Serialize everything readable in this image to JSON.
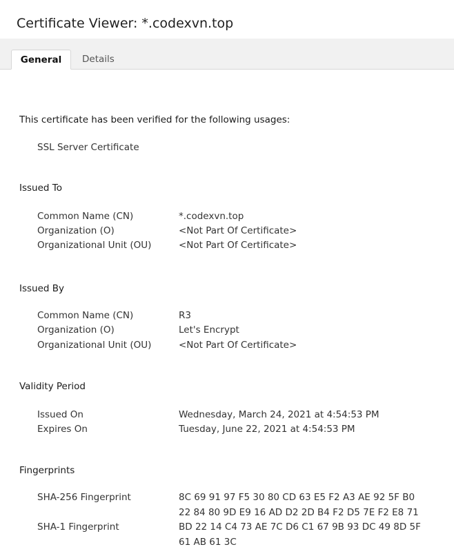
{
  "window": {
    "title": "Certificate Viewer: *.codexvn.top"
  },
  "tabs": [
    {
      "label": "General",
      "active": true
    },
    {
      "label": "Details",
      "active": false
    }
  ],
  "general": {
    "verified_text": "This certificate has been verified for the following usages:",
    "usage": "SSL Server Certificate",
    "issued_to": {
      "heading": "Issued To",
      "common_name_label": "Common Name (CN)",
      "common_name_value": "*.codexvn.top",
      "organization_label": "Organization (O)",
      "organization_value": "<Not Part Of Certificate>",
      "org_unit_label": "Organizational Unit (OU)",
      "org_unit_value": "<Not Part Of Certificate>"
    },
    "issued_by": {
      "heading": "Issued By",
      "common_name_label": "Common Name (CN)",
      "common_name_value": "R3",
      "organization_label": "Organization (O)",
      "organization_value": "Let's Encrypt",
      "org_unit_label": "Organizational Unit (OU)",
      "org_unit_value": "<Not Part Of Certificate>"
    },
    "validity": {
      "heading": "Validity Period",
      "issued_on_label": "Issued On",
      "issued_on_value": "Wednesday, March 24, 2021 at 4:54:53 PM",
      "expires_on_label": "Expires On",
      "expires_on_value": "Tuesday, June 22, 2021 at 4:54:53 PM"
    },
    "fingerprints": {
      "heading": "Fingerprints",
      "sha256_label": "SHA-256 Fingerprint",
      "sha256_line1": "8C 69 91 97 F5 30 80 CD 63 E5 F2 A3 AE 92 5F B0",
      "sha256_line2": "22 84 80 9D E9 16 AD D2 2D B4 F2 D5 7E F2 E8 71",
      "sha1_label": "SHA-1 Fingerprint",
      "sha1_line1": "BD 22 14 C4 73 AE 7C D6 C1 67 9B 93 DC 49 8D 5F",
      "sha1_line2": "61 AB 61 3C"
    }
  }
}
